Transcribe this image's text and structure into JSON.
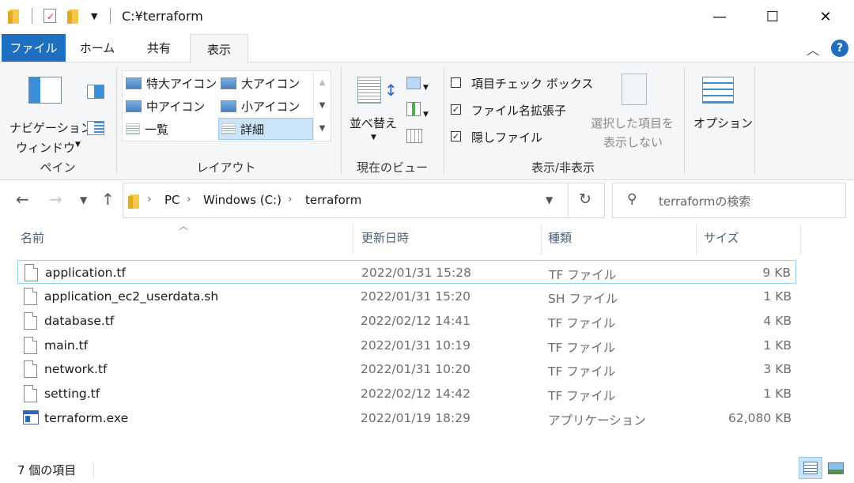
{
  "window": {
    "title": "C:¥terraform",
    "minimize": "—",
    "maximize": "☐",
    "close": "✕"
  },
  "tabs": [
    "ファイル",
    "ホーム",
    "共有",
    "表示"
  ],
  "ribbon": {
    "pane": {
      "nav_pane_line1": "ナビゲーション",
      "nav_pane_line2": "ウィンドウ",
      "label": "ペイン"
    },
    "layout": {
      "items": [
        "特大アイコン",
        "大アイコン",
        "中アイコン",
        "小アイコン",
        "一覧",
        "詳細"
      ],
      "selected": "詳細",
      "label": "レイアウト"
    },
    "current_view": {
      "sort_label": "並べ替え",
      "label": "現在のビュー"
    },
    "show_hide": {
      "checkboxes": [
        {
          "label": "項目チェック ボックス",
          "checked": false
        },
        {
          "label": "ファイル名拡張子",
          "checked": true
        },
        {
          "label": "隠しファイル",
          "checked": true
        }
      ],
      "hide_selected_line1": "選択した項目を",
      "hide_selected_line2": "表示しない",
      "label": "表示/非表示"
    },
    "options_label": "オプション"
  },
  "address": {
    "crumbs": [
      "PC",
      "Windows (C:)",
      "terraform"
    ],
    "search_placeholder": "terraformの検索"
  },
  "columns": {
    "name": "名前",
    "date": "更新日時",
    "type": "種類",
    "size": "サイズ"
  },
  "files": [
    {
      "name": "application.tf",
      "date": "2022/01/31 15:28",
      "type": "TF ファイル",
      "size": "9 KB",
      "icon": "document-icon"
    },
    {
      "name": "application_ec2_userdata.sh",
      "date": "2022/01/31 15:20",
      "type": "SH ファイル",
      "size": "1 KB",
      "icon": "document-icon"
    },
    {
      "name": "database.tf",
      "date": "2022/02/12 14:41",
      "type": "TF ファイル",
      "size": "4 KB",
      "icon": "document-icon"
    },
    {
      "name": "main.tf",
      "date": "2022/01/31 10:19",
      "type": "TF ファイル",
      "size": "1 KB",
      "icon": "document-icon"
    },
    {
      "name": "network.tf",
      "date": "2022/01/31 10:20",
      "type": "TF ファイル",
      "size": "3 KB",
      "icon": "document-icon"
    },
    {
      "name": "setting.tf",
      "date": "2022/02/12 14:42",
      "type": "TF ファイル",
      "size": "1 KB",
      "icon": "document-icon"
    },
    {
      "name": "terraform.exe",
      "date": "2022/01/19 18:29",
      "type": "アプリケーション",
      "size": "62,080 KB",
      "icon": "application-icon"
    }
  ],
  "status": {
    "item_count": "7 個の項目"
  },
  "colors": {
    "file_tab": "#1e6fbf",
    "selection_border": "#99d1ff",
    "ribbon_bg": "#f5f6f7"
  }
}
